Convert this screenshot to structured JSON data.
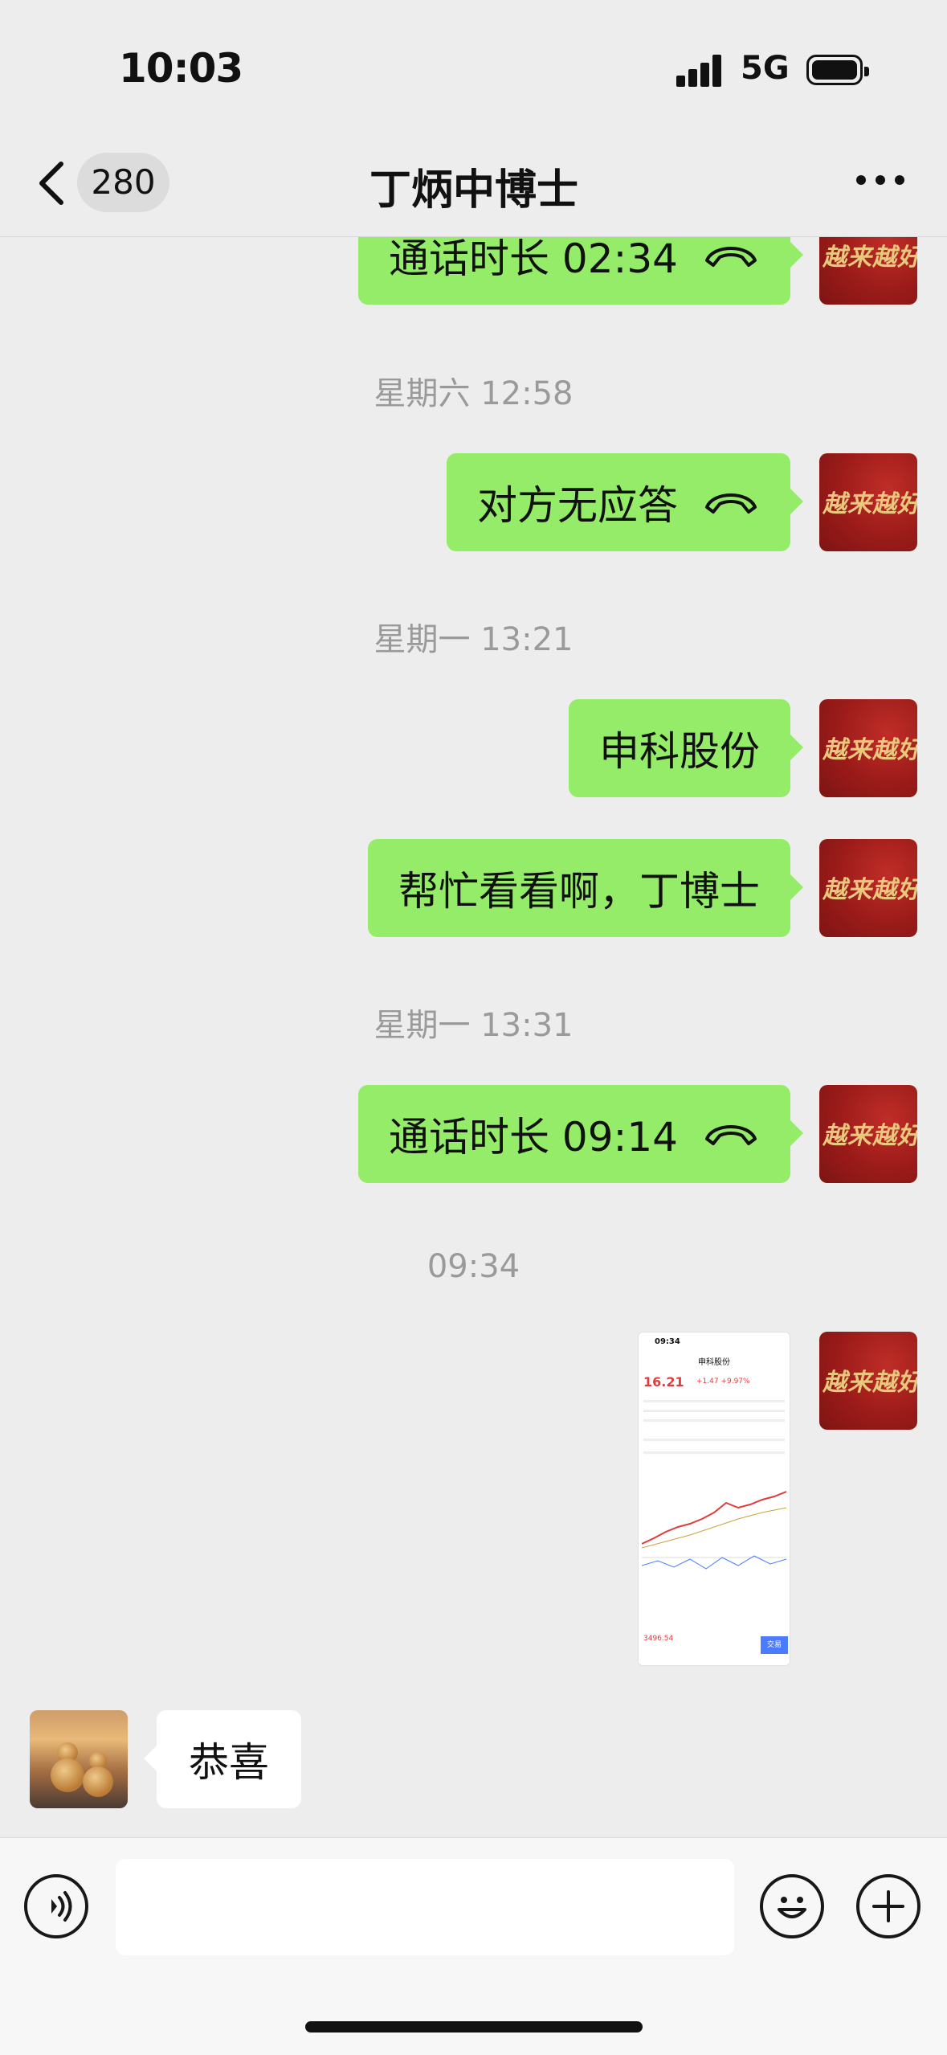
{
  "status_bar": {
    "time": "10:03",
    "network": "5G"
  },
  "nav": {
    "unread_count": "280",
    "title": "丁炳中博士"
  },
  "avatars": {
    "my_avatar_text": "越来越好"
  },
  "messages": [
    {
      "type": "call",
      "side": "out",
      "text": "通话时长 02:34"
    },
    {
      "type": "timestamp",
      "text": "星期六 12:58"
    },
    {
      "type": "call",
      "side": "out",
      "text": "对方无应答"
    },
    {
      "type": "timestamp",
      "text": "星期一 13:21"
    },
    {
      "type": "text",
      "side": "out",
      "text": "申科股份"
    },
    {
      "type": "text",
      "side": "out",
      "text": "帮忙看看啊，丁博士"
    },
    {
      "type": "timestamp",
      "text": "星期一 13:31"
    },
    {
      "type": "call",
      "side": "out",
      "text": "通话时长 09:14"
    },
    {
      "type": "timestamp",
      "text": "09:34"
    },
    {
      "type": "image",
      "side": "out"
    },
    {
      "type": "text",
      "side": "in",
      "text": "恭喜"
    }
  ],
  "screenshot_thumb": {
    "time": "09:34",
    "stock_name": "申科股份",
    "price": "16.21",
    "change": "+1.47 +9.97%",
    "bottom_value": "3496.54",
    "trade_label": "交易"
  },
  "input": {
    "placeholder": ""
  },
  "colors": {
    "bubble_out": "#95ec69",
    "bubble_in": "#ffffff",
    "background": "#ededed",
    "avatar_red": "#9a1b19"
  }
}
